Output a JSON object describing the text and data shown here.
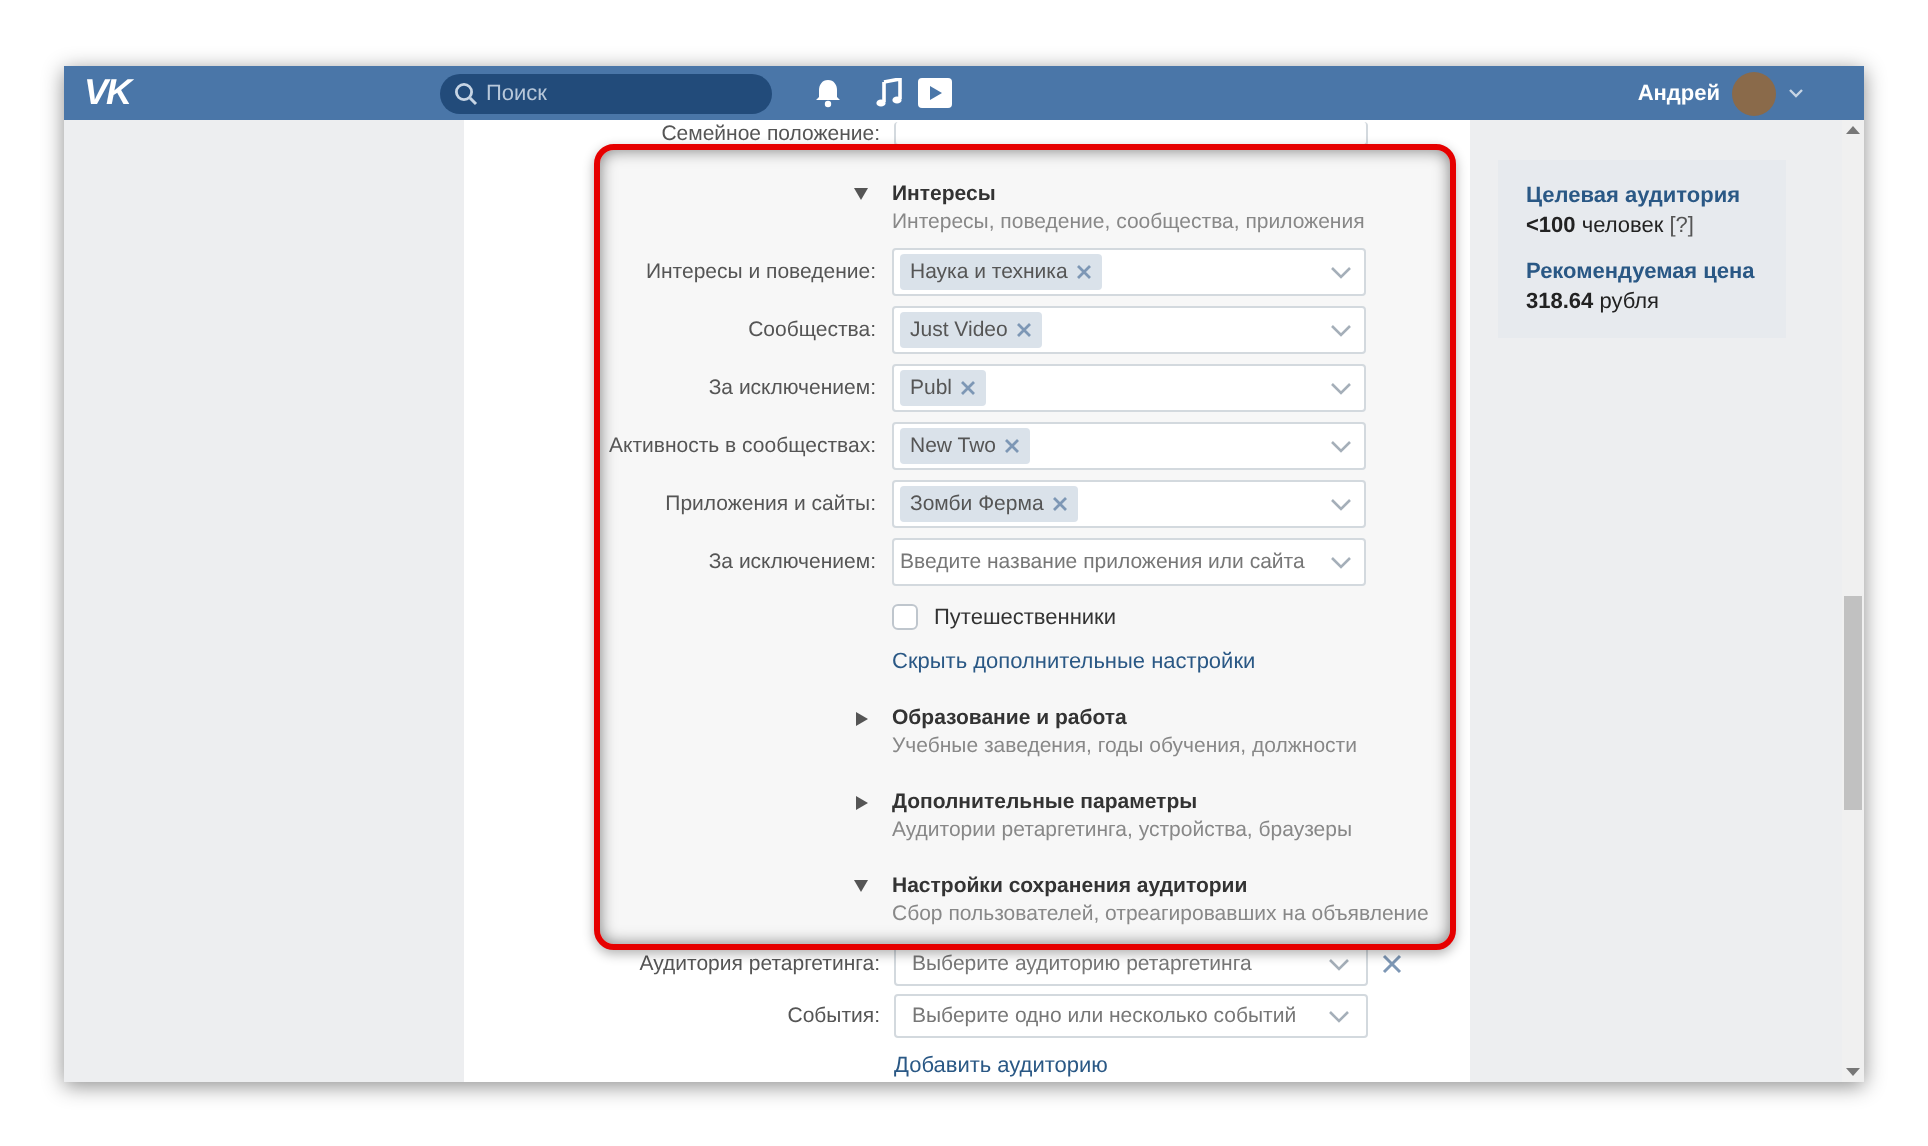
{
  "header": {
    "logo": "VK",
    "search": {
      "placeholder": "Поиск"
    },
    "user": {
      "name": "Андрей"
    }
  },
  "form_top": {
    "label": "Семейное положение:"
  },
  "sections": [
    {
      "title": "Интересы",
      "subtitle": "Интересы, поведение, сообщества, приложения",
      "expanded": true,
      "fields": [
        {
          "label": "Интересы и поведение:",
          "tags": [
            "Наука и техника"
          ]
        },
        {
          "label": "Сообщества:",
          "tags": [
            "Just Video"
          ]
        },
        {
          "label": "За исключением:",
          "tags": [
            "Publ"
          ]
        },
        {
          "label": "Активность в сообществах:",
          "tags": [
            "New Two"
          ]
        },
        {
          "label": "Приложения и сайты:",
          "tags": [
            "Зомби Ферма"
          ]
        },
        {
          "label": "За исключением:",
          "placeholder": "Введите название приложения или сайта"
        }
      ],
      "checkbox": {
        "label": "Путешественники",
        "checked": false
      },
      "link": "Скрыть дополнительные настройки"
    },
    {
      "title": "Образование и работа",
      "subtitle": "Учебные заведения, годы обучения, должности",
      "expanded": false
    },
    {
      "title": "Дополнительные параметры",
      "subtitle": "Аудитории ретаргетинга, устройства, браузеры",
      "expanded": false
    },
    {
      "title": "Настройки сохранения аудитории",
      "subtitle": "Сбор пользователей, отреагировавших на объявление",
      "expanded": true
    }
  ],
  "retargeting_fields": [
    {
      "label": "Аудитория ретаргетинга:",
      "placeholder": "Выберите аудиторию ретаргетинга",
      "removable": true
    },
    {
      "label": "События:",
      "placeholder": "Выберите одно или несколько событий",
      "removable": false
    }
  ],
  "add_link": "Добавить аудиторию",
  "summary": {
    "audience_title": "Целевая аудитория",
    "audience_value": "<100",
    "audience_unit": "человек",
    "help": "[?]",
    "price_title": "Рекомендуемая цена",
    "price_value": "318.64",
    "price_unit": "рубля"
  }
}
